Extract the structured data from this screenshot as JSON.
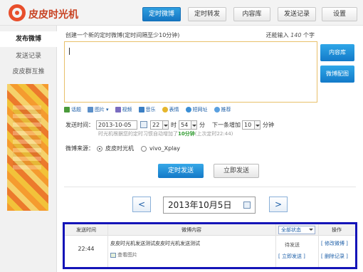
{
  "app": {
    "title": "皮皮时光机"
  },
  "nav": {
    "tabs": [
      {
        "label": "定时微博",
        "active": true
      },
      {
        "label": "定时转发",
        "active": false
      },
      {
        "label": "内容库",
        "active": false
      },
      {
        "label": "发送记录",
        "active": false
      },
      {
        "label": "设置",
        "active": false
      }
    ]
  },
  "sidebar": {
    "items": [
      {
        "label": "发布微博",
        "active": true
      },
      {
        "label": "发送记录",
        "active": false
      },
      {
        "label": "皮皮群互推",
        "active": false
      }
    ]
  },
  "compose": {
    "hint": "创建一个新的定时微博(定时间隔至少10分钟)",
    "remaining_prefix": "还能输入",
    "remaining_count": "140",
    "remaining_suffix": "个字",
    "text_value": "",
    "side_buttons": {
      "library": "内容库",
      "config": "微博配图"
    },
    "toolbar": [
      {
        "label": "话题",
        "icon": "topic-icon",
        "color": "#4a9a3a"
      },
      {
        "label": "图片",
        "icon": "image-icon",
        "color": "#5b8fc9"
      },
      {
        "label": "视频",
        "icon": "video-icon",
        "color": "#7a6cc0"
      },
      {
        "label": "音乐",
        "icon": "music-icon",
        "color": "#3b7fc4"
      },
      {
        "label": "表情",
        "icon": "emoji-icon",
        "color": "#e6b62c"
      },
      {
        "label": "短网址",
        "icon": "link-icon",
        "color": "#3a8fd6"
      },
      {
        "label": "推荐",
        "icon": "recommend-icon",
        "color": "#5aa0e0"
      }
    ]
  },
  "schedule": {
    "label": "发送时间：",
    "date": "2013-10-05",
    "hour": "22",
    "hour_unit": "时",
    "minute": "54",
    "minute_unit": "分",
    "next_label": "下一条增加",
    "increment": "10",
    "increment_unit": "分钟",
    "note_prefix": "时光机根据您的定时习惯自动增加了",
    "note_highlight": "10分钟",
    "note_suffix": "(上次定时22:44)"
  },
  "source": {
    "label": "微博来源：",
    "options": [
      {
        "label": "皮皮时光机",
        "selected": true
      },
      {
        "label": "vivo_Xplay",
        "selected": false
      }
    ]
  },
  "actions": {
    "schedule_send": "定时发送",
    "send_now": "立即发送"
  },
  "date_nav": {
    "prev": "<",
    "date": "2013年10月5日",
    "next": ">"
  },
  "table": {
    "headers": {
      "time": "发送时间",
      "content": "微博内容",
      "filter": "全部状态",
      "actions": "操作"
    },
    "rows": [
      {
        "time": "22:44",
        "content": "皮皮时光机发送测试皮皮时光机发送测试",
        "image_label": "查看图片",
        "status": "待发送",
        "links": [
          "[ 修改微博 ]",
          "[ 立即发送 ]",
          "[ 删除记录 ]"
        ]
      }
    ]
  },
  "colors": {
    "brand": "#c84222",
    "accent_blue": "#1576c3",
    "highlight_border": "#1414b8"
  }
}
